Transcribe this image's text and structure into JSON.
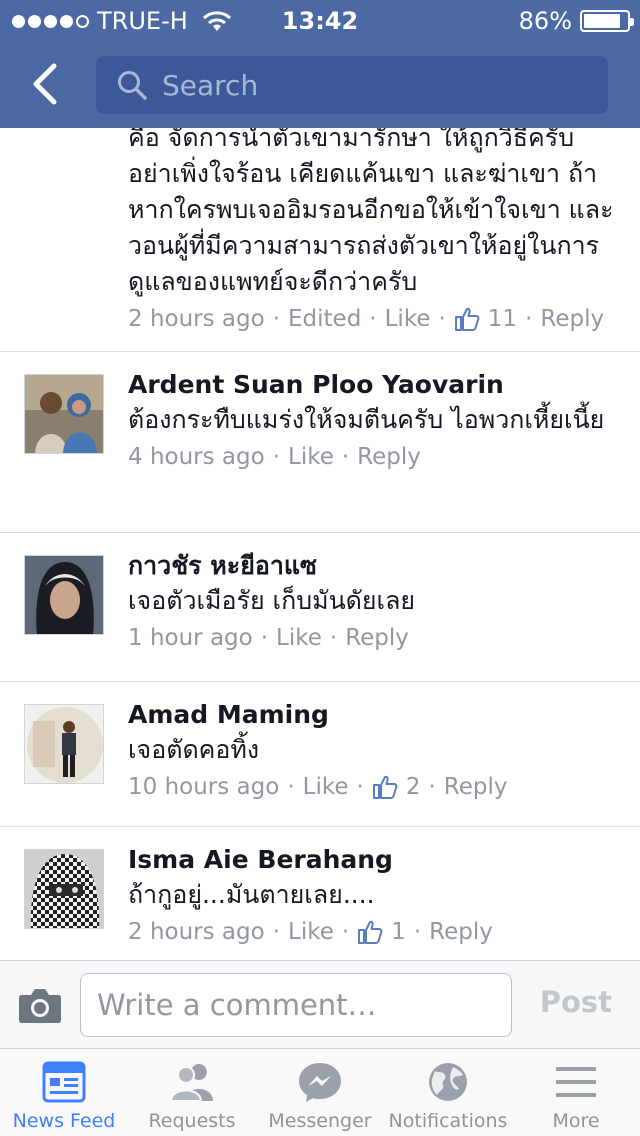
{
  "status_bar": {
    "carrier": "TRUE-H",
    "time": "13:42",
    "battery": "86%",
    "battery_level": 0.86,
    "signal_bars": 4
  },
  "search": {
    "placeholder": "Search"
  },
  "comments": [
    {
      "name": "",
      "text": "คือ จัดการนำตัวเขามารักษา ให้ถูกวิธีครับ อย่าเพิ่งใจร้อน เคียดแค้นเขา และฆ่าเขา ถ้าหากใครพบเจออิมรอนอีกขอให้เข้าใจเขา และวอนผู้ที่มีความสามารถส่งตัวเขาให้อยู่ในการดูแลของแพทย์จะดีกว่าครับ",
      "time": "2 hours ago",
      "edited": "Edited",
      "like": "Like",
      "likes": "11",
      "reply": "Reply"
    },
    {
      "name": "Ardent Suan Ploo Yaovarin",
      "text": "ต้องกระทืบแมร่งให้จมตีนครับ ไอพวกเหี้ยเนี้ย",
      "time": "4 hours ago",
      "like": "Like",
      "reply": "Reply"
    },
    {
      "name": "กาวชัร หะยีอาแซ",
      "text": "เจอตัวเมือรัย  เก็บมันดัยเลย",
      "time": "1 hour ago",
      "like": "Like",
      "reply": "Reply"
    },
    {
      "name": "Amad Maming",
      "text": "เจอตัดคอทิ้ง",
      "time": "10 hours ago",
      "like": "Like",
      "likes": "2",
      "reply": "Reply"
    },
    {
      "name": "Isma Aie Berahang",
      "text": "ถ้ากูอยู่...มันตายเลย....",
      "time": "2 hours ago",
      "like": "Like",
      "likes": "1",
      "reply": "Reply"
    }
  ],
  "composer": {
    "placeholder": "Write a comment…",
    "post_label": "Post"
  },
  "tabs": [
    {
      "label": "News Feed",
      "icon": "news-feed-icon",
      "active": true
    },
    {
      "label": "Requests",
      "icon": "friend-requests-icon",
      "active": false
    },
    {
      "label": "Messenger",
      "icon": "messenger-icon",
      "active": false
    },
    {
      "label": "Notifications",
      "icon": "globe-icon",
      "active": false
    },
    {
      "label": "More",
      "icon": "menu-icon",
      "active": false
    }
  ],
  "colors": {
    "header": "#4c69a4",
    "search_bg": "#3b5998",
    "active_tab": "#4080ff",
    "meta_text": "#9197a3"
  }
}
